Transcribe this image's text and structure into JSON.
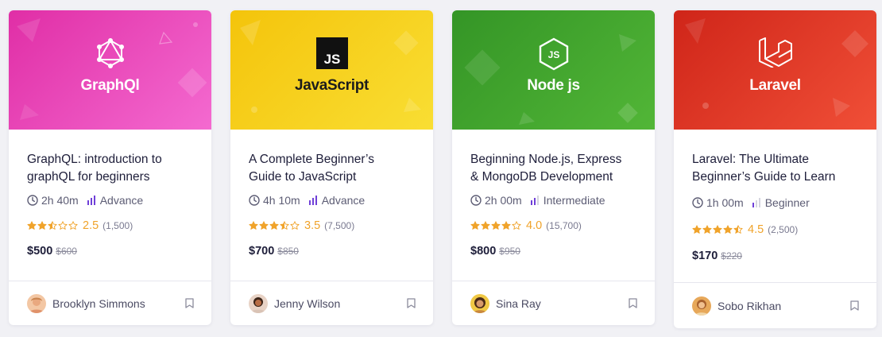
{
  "courses": [
    {
      "brand": "GraphQl",
      "logo_icon": "graphql-logo-icon",
      "color_a": "#e93ab3",
      "color_b": "#f25ec8",
      "title_line1": "GraphQL: introduction to",
      "title_line2": "graphQL for beginners",
      "duration": "2h 40m",
      "level": "Advance",
      "level_bars": 3,
      "rating": 2.5,
      "rating_text": "2.5",
      "reviews": "(1,500)",
      "price": "$500",
      "old_price": "$600",
      "author": "Brooklyn Simmons"
    },
    {
      "brand": "JavaScript",
      "logo_text": "JS",
      "logo_icon": "javascript-logo-icon",
      "color_a": "#f5c80f",
      "color_b": "#f8dc2a",
      "title_line1": "A Complete Beginner’s",
      "title_line2": "Guide to JavaScript",
      "duration": "4h 10m",
      "level": "Advance",
      "level_bars": 3,
      "rating": 3.5,
      "rating_text": "3.5",
      "reviews": "(7,500)",
      "price": "$700",
      "old_price": "$850",
      "author": "Jenny Wilson"
    },
    {
      "brand": "Node js",
      "logo_icon": "nodejs-logo-icon",
      "color_a": "#3d9c2b",
      "color_b": "#4fb335",
      "title_line1": "Beginning Node.js, Express",
      "title_line2": "& MongoDB Development",
      "duration": "2h 00m",
      "level": "Intermediate",
      "level_bars": 2,
      "rating": 4.0,
      "rating_text": "4.0",
      "reviews": "(15,700)",
      "price": "$800",
      "old_price": "$950",
      "author": "Sina Ray"
    },
    {
      "brand": "Laravel",
      "logo_icon": "laravel-logo-icon",
      "color_a": "#d7281f",
      "color_b": "#ee4b35",
      "title_line1": "Laravel: The Ultimate",
      "title_line2": "Beginner’s Guide to Learn",
      "duration": "1h 00m",
      "level": "Beginner",
      "level_bars": 1,
      "rating": 4.5,
      "rating_text": "4.5",
      "reviews": "(2,500)",
      "price": "$170",
      "old_price": "$220",
      "author": "Sobo Rikhan"
    }
  ],
  "colors": {
    "star": "#f0a32a",
    "level_active": "#6f3fd8",
    "level_inactive": "#d5d5df"
  },
  "icons": {
    "clock": "clock-icon",
    "level": "level-bars-icon",
    "star": "star-icon",
    "bookmark": "bookmark-icon"
  }
}
